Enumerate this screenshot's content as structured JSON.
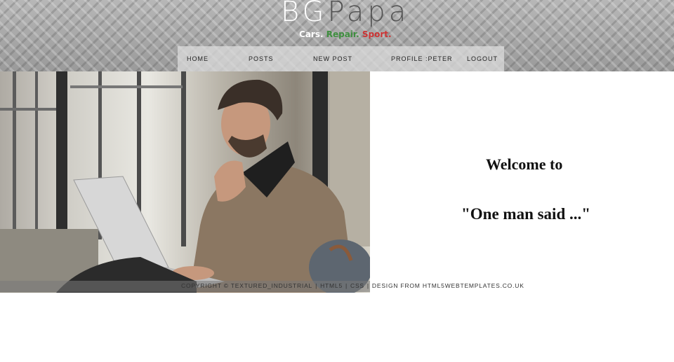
{
  "header": {
    "logo_part1": "BG",
    "logo_part2": "Papa",
    "tagline_1": "Cars.",
    "tagline_2": "Repair.",
    "tagline_3": "Sport."
  },
  "nav": {
    "home": "HOME",
    "posts": "POSTS",
    "new_post": "NEW POST",
    "profile": "PROFILE :PETER",
    "logout": "LOGOUT"
  },
  "main": {
    "welcome": "Welcome to",
    "quote": "\"One man said ...\""
  },
  "footer": {
    "copyright": "COPYRIGHT © TEXTURED_INDUSTRIAL",
    "sep": "|",
    "html5": "HTML5",
    "css": "CSS",
    "design": "DESIGN FROM HTML5WEBTEMPLATES.CO.UK"
  },
  "colors": {
    "tagline_cars": "#ffffff",
    "tagline_repair": "#3f8f3f",
    "tagline_sport": "#cc3333"
  }
}
